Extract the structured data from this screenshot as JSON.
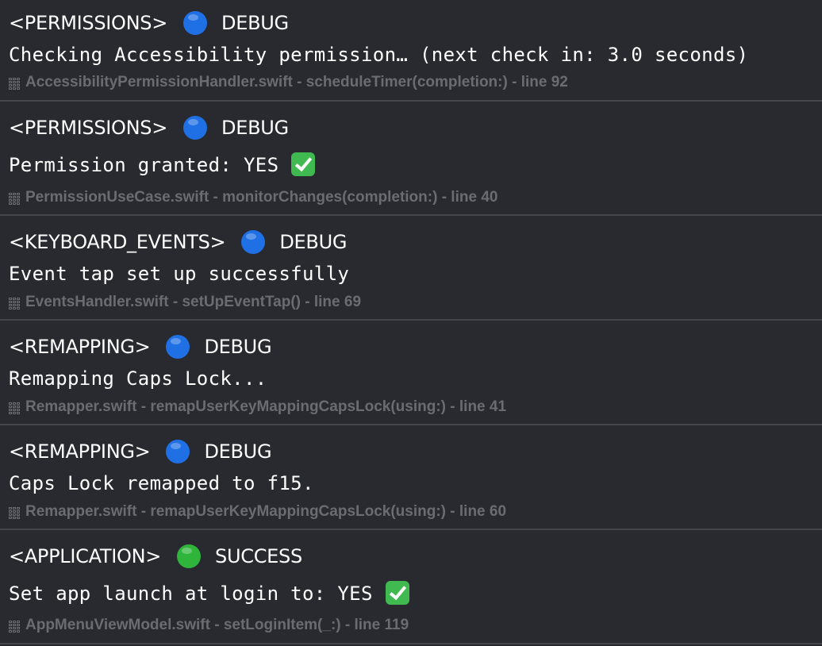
{
  "colors": {
    "background": "#292a30",
    "separator": "#45464c",
    "text": "#ffffff",
    "source_text": "#6b6c71",
    "debug_dot": "#1f6fe5",
    "success_dot": "#2fb43c",
    "check_box": "#3fb950"
  },
  "entries": [
    {
      "category": "<PERMISSIONS>",
      "level_icon": "blue-circle-icon",
      "level": "DEBUG",
      "message": "Checking Accessibility permission… (next check in: 3.0 seconds)",
      "message_icon": "",
      "source": "AccessibilityPermissionHandler.swift - scheduleTimer(completion:) - line 92"
    },
    {
      "category": "<PERMISSIONS>",
      "level_icon": "blue-circle-icon",
      "level": "DEBUG",
      "message": "Permission granted: YES",
      "message_icon": "check-mark-button-icon",
      "source": "PermissionUseCase.swift - monitorChanges(completion:) - line 40"
    },
    {
      "category": "<KEYBOARD_EVENTS>",
      "level_icon": "blue-circle-icon",
      "level": "DEBUG",
      "message": "Event tap set up successfully",
      "message_icon": "",
      "source": "EventsHandler.swift - setUpEventTap() - line 69"
    },
    {
      "category": "<REMAPPING>",
      "level_icon": "blue-circle-icon",
      "level": "DEBUG",
      "message": "Remapping Caps Lock...",
      "message_icon": "",
      "source": "Remapper.swift - remapUserKeyMappingCapsLock(using:) - line 41"
    },
    {
      "category": "<REMAPPING>",
      "level_icon": "blue-circle-icon",
      "level": "DEBUG",
      "message": "Caps Lock remapped to f15.",
      "message_icon": "",
      "source": "Remapper.swift - remapUserKeyMappingCapsLock(using:) - line 60"
    },
    {
      "category": "<APPLICATION>",
      "level_icon": "green-circle-icon",
      "level": "SUCCESS",
      "message": "Set app launch at login to: YES",
      "message_icon": "check-mark-button-icon",
      "source": "AppMenuViewModel.swift - setLoginItem(_:) - line 119"
    }
  ]
}
